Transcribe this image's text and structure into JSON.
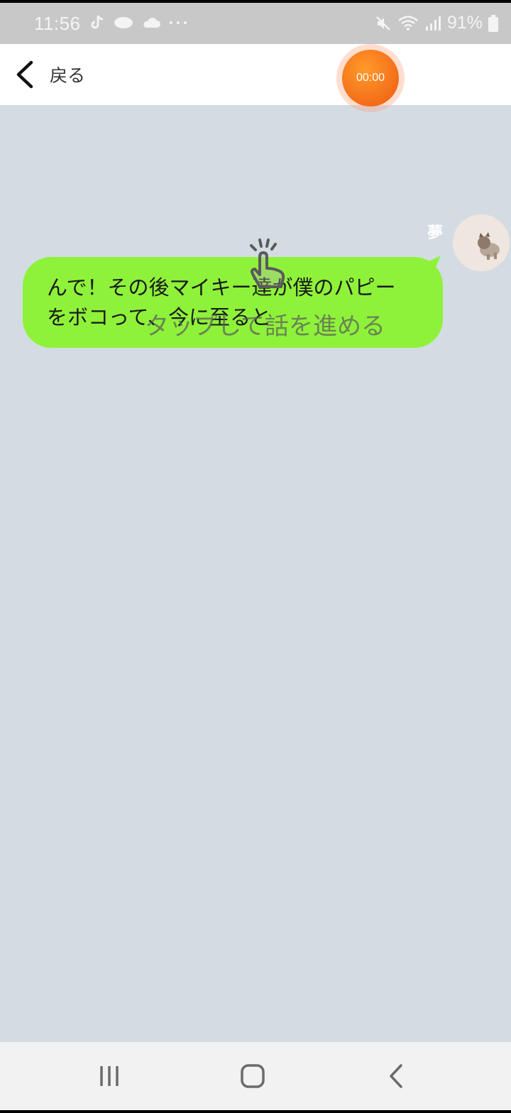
{
  "status_bar": {
    "time": "11:56",
    "battery": "91%",
    "icons": [
      "tiktok-icon",
      "spoon-icon",
      "cloud-icon",
      "more-dots-icon",
      "mute-icon",
      "wifi-icon",
      "signal-icon",
      "battery-icon"
    ]
  },
  "header": {
    "back_label": "戻る",
    "timer": "00:00",
    "accent_color": "#f26418"
  },
  "chat": {
    "sender_name": "夢",
    "message_line1": "んで！その後マイキー達が僕のパピー",
    "message_line2": "をボコって、今に至ると",
    "bubble_color": "#8ff23a",
    "background_color": "#d4dce3"
  },
  "overlay": {
    "tap_hint": "タップして話を進める",
    "icon": "tap-hand-icon"
  },
  "nav_bar": {
    "icons": [
      "recent-apps-icon",
      "home-icon",
      "back-icon"
    ]
  }
}
